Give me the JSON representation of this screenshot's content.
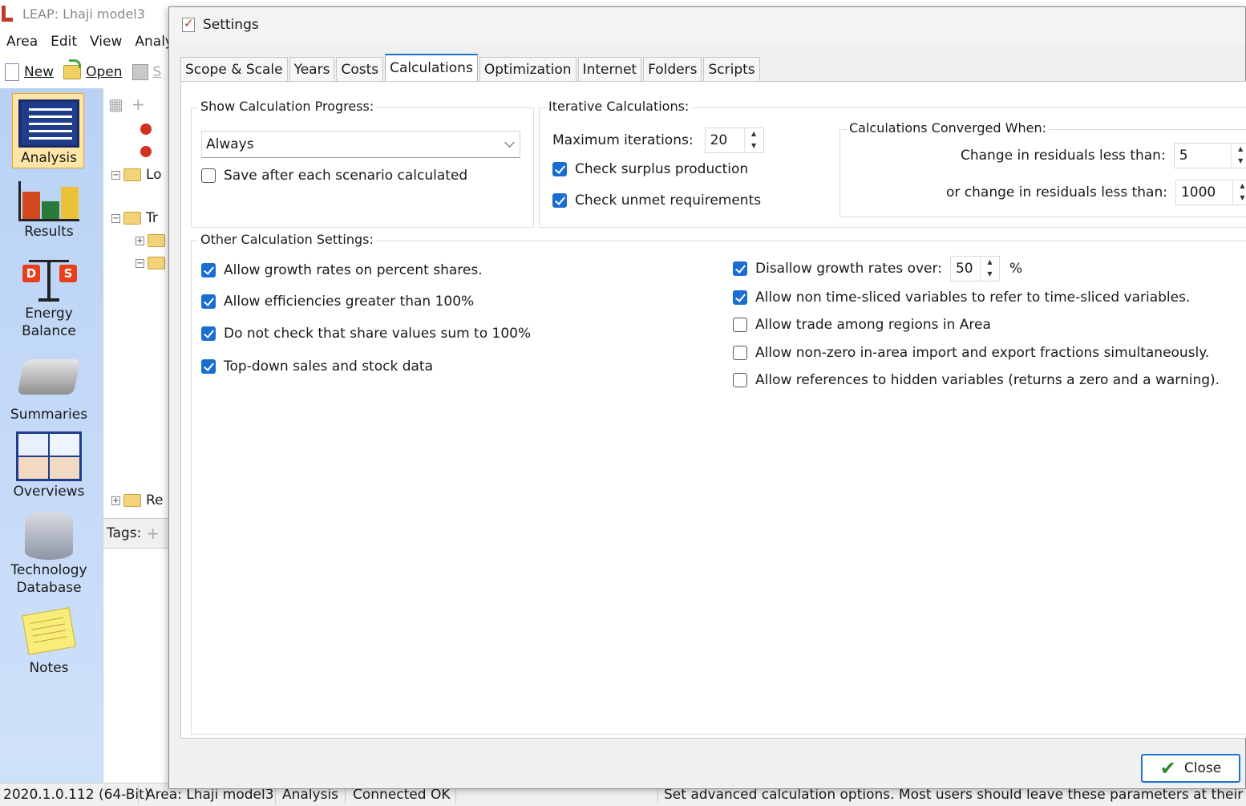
{
  "app": {
    "title": "LEAP: Lhaji model3",
    "menu": [
      "Area",
      "Edit",
      "View",
      "Analy"
    ],
    "toolbar": {
      "new_label": "New",
      "open_label": "Open",
      "save_label": "S"
    }
  },
  "sidebar": {
    "items": [
      {
        "label": "Analysis",
        "icon": "analysis-icon"
      },
      {
        "label": "Results",
        "icon": "results-icon"
      },
      {
        "label": "Energy Balance",
        "icon": "energy-balance-icon"
      },
      {
        "label": "Summaries",
        "icon": "summaries-icon"
      },
      {
        "label": "Overviews",
        "icon": "overviews-icon"
      },
      {
        "label": "Technology Database",
        "icon": "technology-database-icon"
      },
      {
        "label": "Notes",
        "icon": "notes-icon"
      }
    ]
  },
  "tree": {
    "rows": [
      "Lo",
      "Tr",
      "Re"
    ],
    "tags_label": "Tags:"
  },
  "dialog": {
    "title": "Settings",
    "tabs": [
      "Scope & Scale",
      "Years",
      "Costs",
      "Calculations",
      "Optimization",
      "Internet",
      "Folders",
      "Scripts"
    ],
    "active_tab": "Calculations",
    "progress": {
      "legend": "Show Calculation Progress:",
      "selected": "Always",
      "save_after_label": "Save after each scenario calculated",
      "save_after_checked": false
    },
    "iterative": {
      "legend": "Iterative Calculations:",
      "max_iter_label": "Maximum iterations:",
      "max_iter_value": "20",
      "surplus_label": "Check surplus production",
      "surplus_checked": true,
      "unmet_label": "Check unmet requirements",
      "unmet_checked": true
    },
    "converged": {
      "legend": "Calculations Converged When:",
      "change_label": "Change in residuals less than:",
      "change_value": "5",
      "or_change_label": "or change in residuals less than:",
      "or_change_value": "1000"
    },
    "other": {
      "legend": "Other Calculation Settings:",
      "left": [
        {
          "label": "Allow growth rates on percent shares.",
          "checked": true
        },
        {
          "label": "Allow efficiencies greater than 100%",
          "checked": true
        },
        {
          "label": "Do not check that share values sum to 100%",
          "checked": true
        },
        {
          "label": "Top-down sales and stock data",
          "checked": true
        }
      ],
      "disallow_label": "Disallow growth rates over:",
      "disallow_checked": true,
      "disallow_value": "50",
      "disallow_unit": "%",
      "right": [
        {
          "label": "Allow non time-sliced variables to refer to time-sliced variables.",
          "checked": true
        },
        {
          "label": "Allow trade among regions in Area",
          "checked": false
        },
        {
          "label": "Allow non-zero in-area import and export fractions simultaneously.",
          "checked": false
        },
        {
          "label": "Allow references to hidden variables (returns a zero and a warning).",
          "checked": false
        }
      ]
    },
    "close_label": "Close"
  },
  "status": {
    "version": "2020.1.0.112 (64-Bit)",
    "area": "Area: Lhaji model3",
    "view": "Analysis",
    "connection": "Connected OK",
    "hint": "Set advanced calculation options.  Most users should leave these parameters at their default"
  },
  "colors": {
    "accent": "#1a6dd1",
    "sidebar": "#c4daf7",
    "selected_sidebar": "#fde6a7"
  }
}
